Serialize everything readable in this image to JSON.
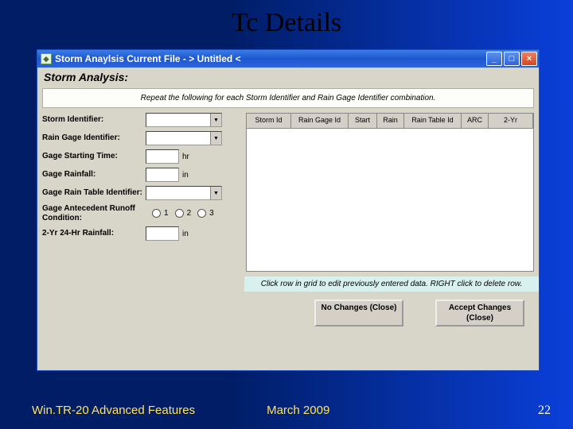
{
  "slide_title": "Tc Details",
  "footer": {
    "left": "Win.TR-20 Advanced Features",
    "center": "March 2009",
    "page": "22"
  },
  "window": {
    "title": "Storm Anaylsis   Current File - > Untitled <",
    "subtitle": "Storm Analysis:",
    "instruction": "Repeat the following for each Storm Identifier and Rain Gage Identifier combination.",
    "labels": {
      "storm_id": "Storm Identifier:",
      "gage_id": "Rain Gage Identifier:",
      "start_time": "Gage Starting Time:",
      "rainfall": "Gage Rainfall:",
      "rain_table": "Gage Rain Table Identifier:",
      "arc": "Gage Antecedent Runoff Condition:",
      "rain24": "2-Yr 24-Hr Rainfall:"
    },
    "units": {
      "hr": "hr",
      "in": "in"
    },
    "radios": {
      "r1": "1",
      "r2": "2",
      "r3": "3"
    },
    "grid_headers": [
      "Storm Id",
      "Rain Gage Id",
      "Start",
      "Rain",
      "Rain Table Id",
      "ARC",
      "2-Yr"
    ],
    "hint": "Click row in grid to edit previously entered data.  RIGHT click to delete row.",
    "buttons": {
      "cancel": "No Changes (Close)",
      "accept": "Accept Changes (Close)"
    }
  }
}
